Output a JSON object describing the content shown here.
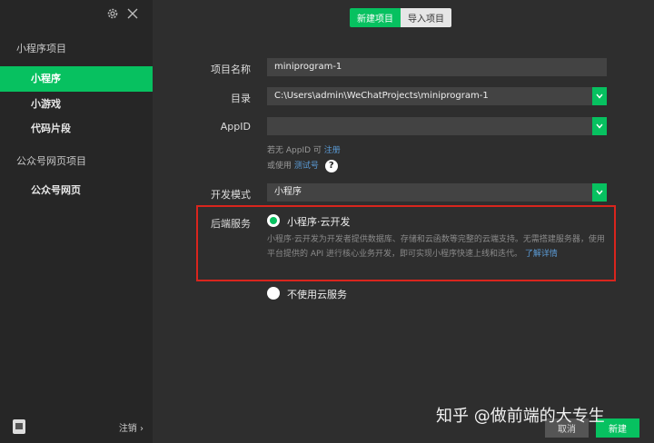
{
  "sidebar": {
    "section1": "小程序项目",
    "items": [
      {
        "label": "小程序",
        "active": true
      },
      {
        "label": "小游戏"
      },
      {
        "label": "代码片段"
      }
    ],
    "section2": "公众号网页项目",
    "items2": [
      {
        "label": "公众号网页"
      }
    ],
    "logout": "注销",
    "logout_chevron": "›",
    "icons": [
      "gear-icon",
      "close-icon"
    ]
  },
  "tabs": [
    "新建项目",
    "导入项目"
  ],
  "form": {
    "name_label": "项目名称",
    "name_value": "miniprogram-1",
    "dir_label": "目录",
    "dir_value": "C:\\Users\\admin\\WeChatProjects\\miniprogram-1",
    "appid_label": "AppID",
    "appid_value": "",
    "hint1_prefix": "若无 AppID 可",
    "hint1_link": "注册",
    "hint2_prefix": "或使用",
    "hint2_link": "测试号",
    "help": "?",
    "mode_label": "开发模式",
    "mode_value": "小程序",
    "backend_label": "后端服务",
    "cloud_option": "小程序·云开发",
    "cloud_desc": "小程序·云开发为开发者提供数据库、存储和云函数等完整的云端支持。无需搭建服务器，使用平台提供的 API 进行核心业务开发，即可实现小程序快速上线和迭代。",
    "learn_more": "了解详情",
    "no_cloud_option": "不使用云服务"
  },
  "footer": {
    "cancel": "取消",
    "create": "新建"
  },
  "watermark": "知乎 @做前端的大专生",
  "colors": {
    "accent": "#07c160",
    "highlight_border": "#d9251d",
    "link": "#5b9bd5"
  }
}
